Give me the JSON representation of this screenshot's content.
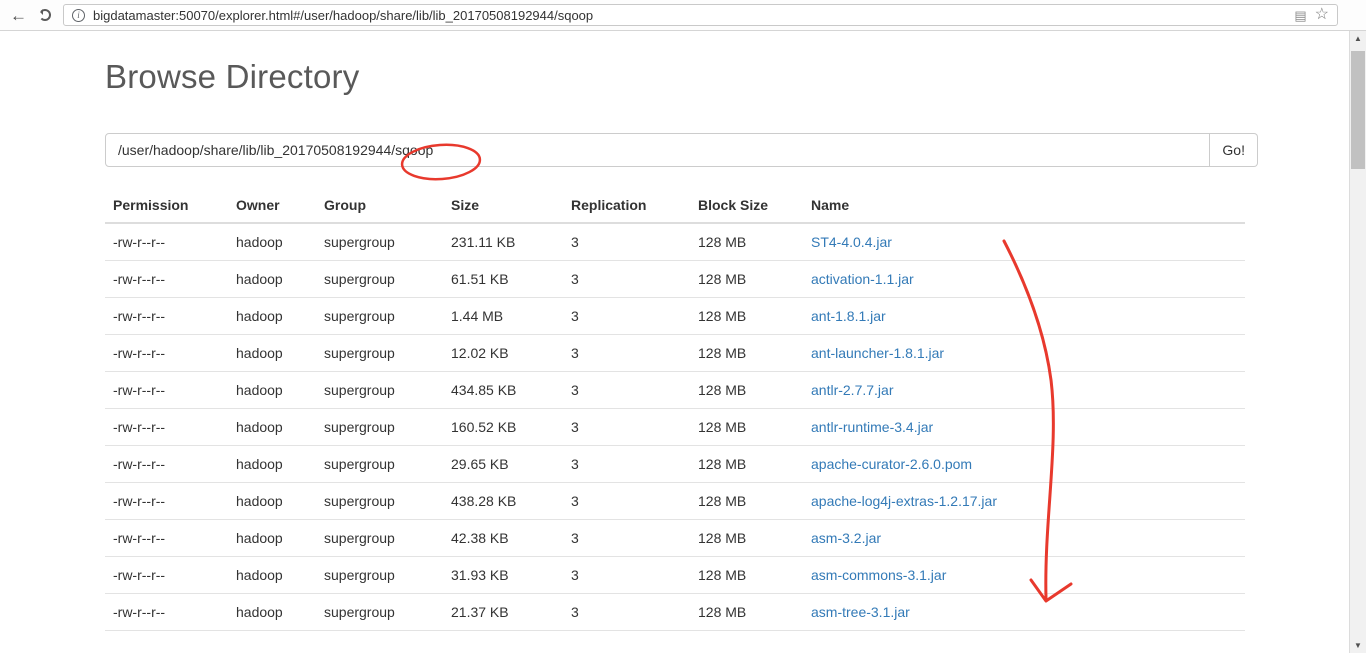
{
  "colors": {
    "link": "#337ab7",
    "annotation": "#e8392d"
  },
  "browser": {
    "url": "bigdatamaster:50070/explorer.html#/user/hadoop/share/lib/lib_20170508192944/sqoop"
  },
  "page": {
    "title": "Browse Directory",
    "path_value": "/user/hadoop/share/lib/lib_20170508192944/sqoop",
    "go_label": "Go!"
  },
  "table": {
    "headers": [
      "Permission",
      "Owner",
      "Group",
      "Size",
      "Replication",
      "Block Size",
      "Name"
    ],
    "rows": [
      {
        "permission": "-rw-r--r--",
        "owner": "hadoop",
        "group": "supergroup",
        "size": "231.11 KB",
        "replication": "3",
        "block_size": "128 MB",
        "name": "ST4-4.0.4.jar"
      },
      {
        "permission": "-rw-r--r--",
        "owner": "hadoop",
        "group": "supergroup",
        "size": "61.51 KB",
        "replication": "3",
        "block_size": "128 MB",
        "name": "activation-1.1.jar"
      },
      {
        "permission": "-rw-r--r--",
        "owner": "hadoop",
        "group": "supergroup",
        "size": "1.44 MB",
        "replication": "3",
        "block_size": "128 MB",
        "name": "ant-1.8.1.jar"
      },
      {
        "permission": "-rw-r--r--",
        "owner": "hadoop",
        "group": "supergroup",
        "size": "12.02 KB",
        "replication": "3",
        "block_size": "128 MB",
        "name": "ant-launcher-1.8.1.jar"
      },
      {
        "permission": "-rw-r--r--",
        "owner": "hadoop",
        "group": "supergroup",
        "size": "434.85 KB",
        "replication": "3",
        "block_size": "128 MB",
        "name": "antlr-2.7.7.jar"
      },
      {
        "permission": "-rw-r--r--",
        "owner": "hadoop",
        "group": "supergroup",
        "size": "160.52 KB",
        "replication": "3",
        "block_size": "128 MB",
        "name": "antlr-runtime-3.4.jar"
      },
      {
        "permission": "-rw-r--r--",
        "owner": "hadoop",
        "group": "supergroup",
        "size": "29.65 KB",
        "replication": "3",
        "block_size": "128 MB",
        "name": "apache-curator-2.6.0.pom"
      },
      {
        "permission": "-rw-r--r--",
        "owner": "hadoop",
        "group": "supergroup",
        "size": "438.28 KB",
        "replication": "3",
        "block_size": "128 MB",
        "name": "apache-log4j-extras-1.2.17.jar"
      },
      {
        "permission": "-rw-r--r--",
        "owner": "hadoop",
        "group": "supergroup",
        "size": "42.38 KB",
        "replication": "3",
        "block_size": "128 MB",
        "name": "asm-3.2.jar"
      },
      {
        "permission": "-rw-r--r--",
        "owner": "hadoop",
        "group": "supergroup",
        "size": "31.93 KB",
        "replication": "3",
        "block_size": "128 MB",
        "name": "asm-commons-3.1.jar"
      },
      {
        "permission": "-rw-r--r--",
        "owner": "hadoop",
        "group": "supergroup",
        "size": "21.37 KB",
        "replication": "3",
        "block_size": "128 MB",
        "name": "asm-tree-3.1.jar"
      }
    ]
  }
}
